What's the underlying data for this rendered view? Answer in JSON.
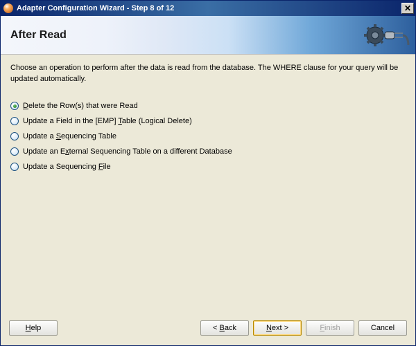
{
  "title": "Adapter Configuration Wizard - Step 8 of 12",
  "header": {
    "title": "After Read"
  },
  "instruction": "Choose an operation to perform after the data is read from the database.  The WHERE clause for your query will be updated automatically.",
  "options": [
    {
      "pre": "",
      "accel": "D",
      "post": "elete the Row(s) that were Read",
      "selected": true
    },
    {
      "pre": "Update a Field in the [EMP] ",
      "accel": "T",
      "post": "able (Logical Delete)",
      "selected": false
    },
    {
      "pre": "Update a ",
      "accel": "S",
      "post": "equencing Table",
      "selected": false
    },
    {
      "pre": "Update an E",
      "accel": "x",
      "post": "ternal Sequencing Table on a different Database",
      "selected": false
    },
    {
      "pre": "Update a Sequencing ",
      "accel": "F",
      "post": "ile",
      "selected": false
    }
  ],
  "buttons": {
    "help_pre": "",
    "help_accel": "H",
    "help_post": "elp",
    "back_pre": "< ",
    "back_accel": "B",
    "back_post": "ack",
    "next_pre": "",
    "next_accel": "N",
    "next_post": "ext >",
    "finish_pre": "",
    "finish_accel": "F",
    "finish_post": "inish",
    "cancel": "Cancel"
  }
}
